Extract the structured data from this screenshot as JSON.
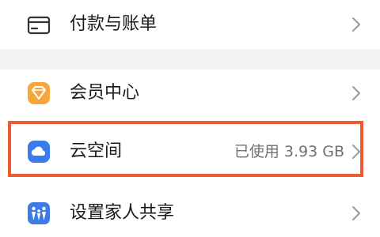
{
  "items": [
    {
      "label": "付款与账单",
      "icon": "card-icon"
    },
    {
      "label": "会员中心",
      "icon": "member-diamond-icon"
    },
    {
      "label": "云空间",
      "icon": "cloud-icon",
      "value": "已使用 3.93 GB"
    },
    {
      "label": "设置家人共享",
      "icon": "family-share-icon"
    }
  ],
  "colors": {
    "highlight_border": "#f05a32",
    "member_icon": "#f6a63a",
    "cloud_icon": "#3a7bf0",
    "family_icon": "#3d7be8",
    "section_gap": "#f3f3f3"
  }
}
